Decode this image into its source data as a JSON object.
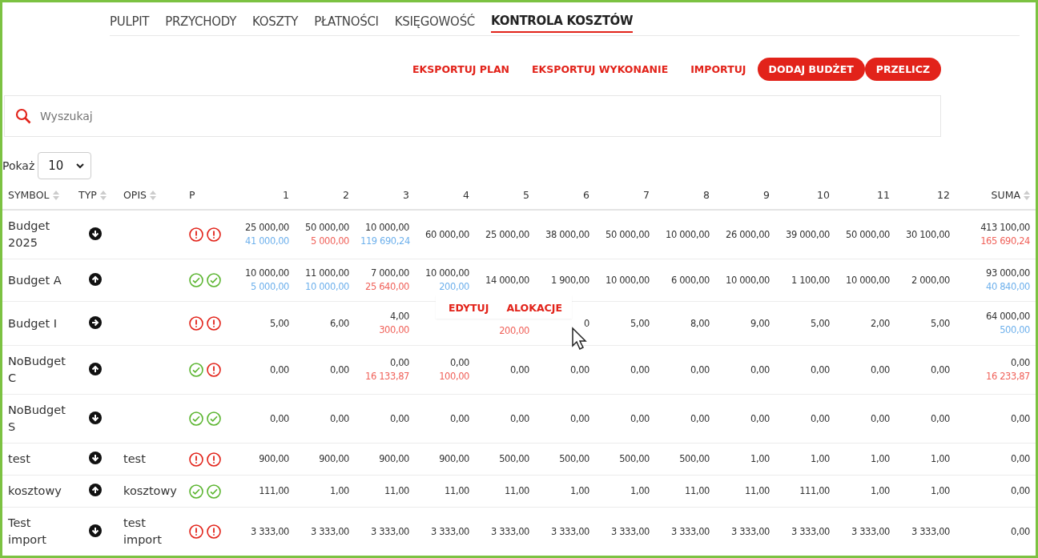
{
  "nav": [
    {
      "label": "PULPIT",
      "selected": false
    },
    {
      "label": "PRZYCHODY",
      "selected": false
    },
    {
      "label": "KOSZTY",
      "selected": false
    },
    {
      "label": "PŁATNOŚCI",
      "selected": false
    },
    {
      "label": "KSIĘGOWOŚĆ",
      "selected": false
    },
    {
      "label": "KONTROLA KOSZTÓW",
      "selected": true
    }
  ],
  "actions": [
    {
      "label": "EKSPORTUJ PLAN",
      "kind": "link"
    },
    {
      "label": "EKSPORTUJ WYKONANIE",
      "kind": "link"
    },
    {
      "label": "IMPORTUJ",
      "kind": "link"
    },
    {
      "label": "DODAJ BUDŻET",
      "kind": "button"
    },
    {
      "label": "PRZELICZ",
      "kind": "button"
    }
  ],
  "search": {
    "placeholder": "Wyszukaj"
  },
  "page_size": {
    "label": "Pokaż",
    "value": "10"
  },
  "table": {
    "columns": [
      {
        "label": "SYMBOL",
        "sortable": true
      },
      {
        "label": "TYP",
        "sortable": true
      },
      {
        "label": "OPIS",
        "sortable": true
      },
      {
        "label": "P",
        "sortable": false
      },
      {
        "label": "1",
        "sortable": false
      },
      {
        "label": "2",
        "sortable": false
      },
      {
        "label": "3",
        "sortable": false
      },
      {
        "label": "4",
        "sortable": false
      },
      {
        "label": "5",
        "sortable": false
      },
      {
        "label": "6",
        "sortable": false
      },
      {
        "label": "7",
        "sortable": false
      },
      {
        "label": "8",
        "sortable": false
      },
      {
        "label": "9",
        "sortable": false
      },
      {
        "label": "10",
        "sortable": false
      },
      {
        "label": "11",
        "sortable": false
      },
      {
        "label": "12",
        "sortable": false
      },
      {
        "label": "SUMA",
        "sortable": true
      }
    ],
    "rows": [
      {
        "symbol": "Budget 2025",
        "kind": "down",
        "flags": [
          {
            "ok": false
          },
          {
            "ok": false
          }
        ],
        "months": [
          {
            "plan": "25 000,00",
            "actual": "41 000,00",
            "over": false
          },
          {
            "plan": "50 000,00",
            "actual": "5 000,00",
            "over": true
          },
          {
            "plan": "10 000,00",
            "actual": "119 690,24",
            "over": false
          },
          {
            "plan": "60 000,00"
          },
          {
            "plan": "25 000,00"
          },
          {
            "plan": "38 000,00"
          },
          {
            "plan": "50 000,00"
          },
          {
            "plan": "10 000,00"
          },
          {
            "plan": "26 000,00"
          },
          {
            "plan": "39 000,00"
          },
          {
            "plan": "50 000,00"
          },
          {
            "plan": "30 100,00"
          }
        ],
        "total": {
          "plan": "413 100,00",
          "actual": "165 690,24",
          "over": true
        }
      },
      {
        "symbol": "Budget A",
        "kind": "up",
        "flags": [
          {
            "ok": true
          },
          {
            "ok": true
          }
        ],
        "months": [
          {
            "plan": "10 000,00",
            "actual": "5 000,00",
            "over": false
          },
          {
            "plan": "11 000,00",
            "actual": "10 000,00",
            "over": false
          },
          {
            "plan": "7 000,00",
            "actual": "25 640,00",
            "over": true
          },
          {
            "plan": "10 000,00",
            "actual": "200,00",
            "over": false
          },
          {
            "plan": "14 000,00"
          },
          {
            "plan": "1 900,00"
          },
          {
            "plan": "10 000,00"
          },
          {
            "plan": "6 000,00"
          },
          {
            "plan": "10 000,00"
          },
          {
            "plan": "1 100,00"
          },
          {
            "plan": "10 000,00"
          },
          {
            "plan": "2 000,00"
          }
        ],
        "total": {
          "plan": "93 000,00",
          "actual": "40 840,00",
          "over": false
        }
      },
      {
        "symbol": "Budget I",
        "kind": "right",
        "flags": [
          {
            "ok": false
          },
          {
            "ok": false
          }
        ],
        "months": [
          {
            "plan": "5,00"
          },
          {
            "plan": "6,00"
          },
          {
            "plan": "4,00",
            "actual": "300,00",
            "over": true
          },
          {
            "menu_open": true
          },
          {
            "actual": "200,00",
            "over": true
          },
          {
            "plan": "0"
          },
          {
            "plan": "5,00"
          },
          {
            "plan": "8,00"
          },
          {
            "plan": "9,00"
          },
          {
            "plan": "5,00"
          },
          {
            "plan": "2,00"
          },
          {
            "plan": "5,00"
          }
        ],
        "total": {
          "plan": "64 000,00",
          "actual": "500,00",
          "over": false
        }
      },
      {
        "symbol": "NoBudget C",
        "kind": "up",
        "flags": [
          {
            "ok": true
          },
          {
            "ok": false
          }
        ],
        "months": [
          {
            "plan": "0,00"
          },
          {
            "plan": "0,00"
          },
          {
            "plan": "0,00",
            "actual": "16 133,87",
            "over": true
          },
          {
            "plan": "0,00",
            "actual": "100,00",
            "over": true
          },
          {
            "plan": "0,00"
          },
          {
            "plan": "0,00"
          },
          {
            "plan": "0,00"
          },
          {
            "plan": "0,00"
          },
          {
            "plan": "0,00"
          },
          {
            "plan": "0,00"
          },
          {
            "plan": "0,00"
          },
          {
            "plan": "0,00"
          }
        ],
        "total": {
          "plan": "0,00",
          "actual": "16 233,87",
          "over": true
        }
      },
      {
        "symbol": "NoBudget S",
        "kind": "down",
        "flags": [
          {
            "ok": true
          },
          {
            "ok": true
          }
        ],
        "months": [
          {
            "plan": "0,00"
          },
          {
            "plan": "0,00"
          },
          {
            "plan": "0,00"
          },
          {
            "plan": "0,00"
          },
          {
            "plan": "0,00"
          },
          {
            "plan": "0,00"
          },
          {
            "plan": "0,00"
          },
          {
            "plan": "0,00"
          },
          {
            "plan": "0,00"
          },
          {
            "plan": "0,00"
          },
          {
            "plan": "0,00"
          },
          {
            "plan": "0,00"
          }
        ],
        "total": {
          "plan": "0,00"
        }
      },
      {
        "symbol": "test",
        "kind": "down",
        "description": "test",
        "flags": [
          {
            "ok": false
          },
          {
            "ok": false
          }
        ],
        "months": [
          {
            "plan": "900,00"
          },
          {
            "plan": "900,00"
          },
          {
            "plan": "900,00"
          },
          {
            "plan": "900,00"
          },
          {
            "plan": "500,00"
          },
          {
            "plan": "500,00"
          },
          {
            "plan": "500,00"
          },
          {
            "plan": "500,00"
          },
          {
            "plan": "1,00"
          },
          {
            "plan": "1,00"
          },
          {
            "plan": "1,00"
          },
          {
            "plan": "1,00"
          }
        ],
        "total": {
          "plan": "0,00"
        }
      },
      {
        "symbol": "kosztowy",
        "kind": "up",
        "description": "kosztowy",
        "flags": [
          {
            "ok": true
          },
          {
            "ok": true
          }
        ],
        "months": [
          {
            "plan": "111,00"
          },
          {
            "plan": "1,00"
          },
          {
            "plan": "11,00"
          },
          {
            "plan": "11,00"
          },
          {
            "plan": "11,00"
          },
          {
            "plan": "1,00"
          },
          {
            "plan": "1,00"
          },
          {
            "plan": "11,00"
          },
          {
            "plan": "11,00"
          },
          {
            "plan": "111,00"
          },
          {
            "plan": "1,00"
          },
          {
            "plan": "1,00"
          }
        ],
        "total": {
          "plan": "0,00"
        }
      },
      {
        "symbol": "Test import",
        "kind": "down",
        "description": "test import",
        "flags": [
          {
            "ok": false
          },
          {
            "ok": false
          }
        ],
        "months": [
          {
            "plan": "3 333,00"
          },
          {
            "plan": "3 333,00"
          },
          {
            "plan": "3 333,00"
          },
          {
            "plan": "3 333,00"
          },
          {
            "plan": "3 333,00"
          },
          {
            "plan": "3 333,00"
          },
          {
            "plan": "3 333,00"
          },
          {
            "plan": "3 333,00"
          },
          {
            "plan": "3 333,00"
          },
          {
            "plan": "3 333,00"
          },
          {
            "plan": "3 333,00"
          },
          {
            "plan": "3 333,00"
          }
        ],
        "total": {
          "plan": "0,00"
        }
      }
    ]
  },
  "context_menu": {
    "items": [
      "EDYTUJ",
      "ALOKACJE"
    ]
  }
}
